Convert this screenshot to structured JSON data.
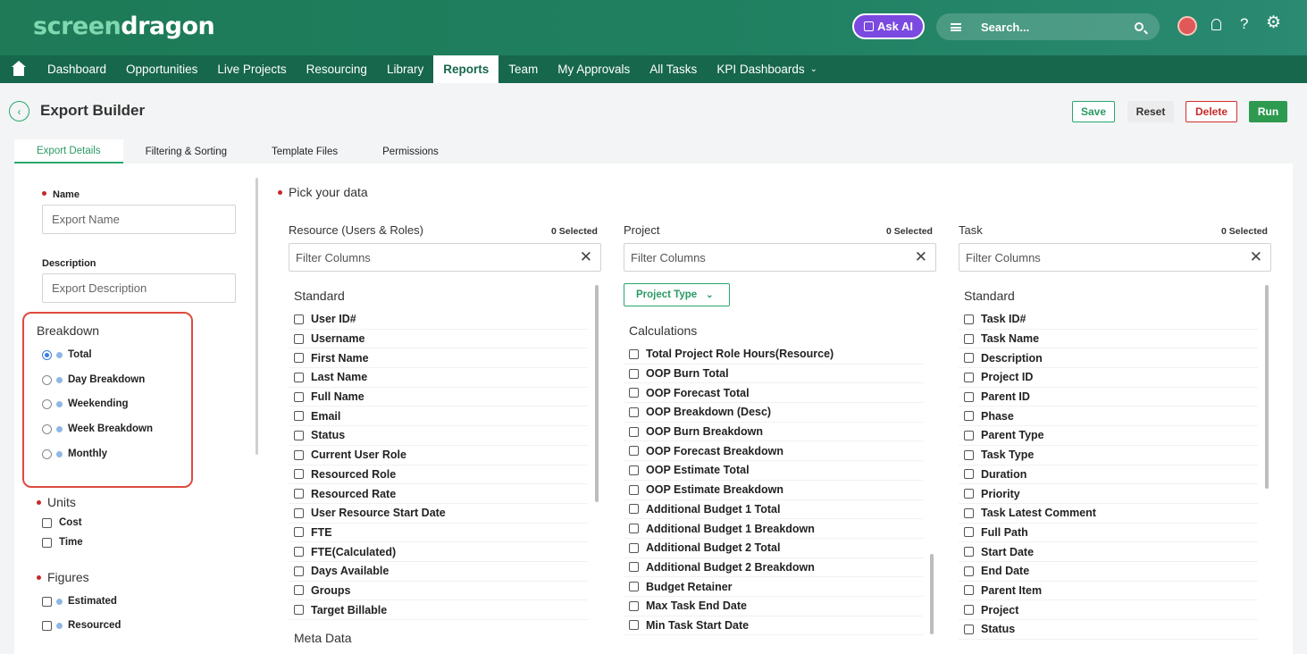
{
  "app": {
    "logo_part1": "screen",
    "logo_part2": "dragon",
    "ask_ai": "Ask AI",
    "search_placeholder": "Search..."
  },
  "nav": {
    "items": [
      "Dashboard",
      "Opportunities",
      "Live Projects",
      "Resourcing",
      "Library",
      "Reports",
      "Team",
      "My Approvals",
      "All Tasks",
      "KPI Dashboards"
    ],
    "active": "Reports"
  },
  "page": {
    "title": "Export Builder",
    "save": "Save",
    "reset": "Reset",
    "delete": "Delete",
    "run": "Run"
  },
  "tabs": [
    "Export Details",
    "Filtering & Sorting",
    "Template Files",
    "Permissions"
  ],
  "form": {
    "name_label": "Name",
    "name_placeholder": "Export Name",
    "desc_label": "Description",
    "desc_placeholder": "Export Description",
    "breakdown_title": "Breakdown",
    "breakdown_options": [
      "Total",
      "Day Breakdown",
      "Weekending",
      "Week Breakdown",
      "Monthly"
    ],
    "breakdown_selected": "Total",
    "units_title": "Units",
    "units": [
      "Cost",
      "Time"
    ],
    "figures_title": "Figures",
    "figures": [
      "Estimated",
      "Resourced"
    ]
  },
  "pick_title": "Pick your data",
  "columns": [
    {
      "title": "Resource (Users & Roles)",
      "selected": "0 Selected",
      "filter_placeholder": "Filter Columns",
      "group": "Standard",
      "items": [
        "User ID#",
        "Username",
        "First Name",
        "Last Name",
        "Full Name",
        "Email",
        "Status",
        "Current User Role",
        "Resourced Role",
        "Resourced Rate",
        "User Resource Start Date",
        "FTE",
        "FTE(Calculated)",
        "Days Available",
        "Groups",
        "Target Billable"
      ],
      "next_group": "Meta Data"
    },
    {
      "title": "Project",
      "selected": "0 Selected",
      "filter_placeholder": "Filter Columns",
      "project_type_button": "Project Type",
      "group": "Calculations",
      "items": [
        "Total Project Role Hours(Resource)",
        "OOP Burn Total",
        "OOP Forecast Total",
        "OOP Breakdown (Desc)",
        "OOP Burn Breakdown",
        "OOP Forecast Breakdown",
        "OOP Estimate Total",
        "OOP Estimate Breakdown",
        "Additional Budget 1 Total",
        "Additional Budget 1 Breakdown",
        "Additional Budget 2 Total",
        "Additional Budget 2 Breakdown",
        "Budget Retainer",
        "Max Task End Date",
        "Min Task Start Date"
      ]
    },
    {
      "title": "Task",
      "selected": "0 Selected",
      "filter_placeholder": "Filter Columns",
      "group": "Standard",
      "items": [
        "Task ID#",
        "Task Name",
        "Description",
        "Project ID",
        "Parent ID",
        "Phase",
        "Parent Type",
        "Task Type",
        "Duration",
        "Priority",
        "Task Latest Comment",
        "Full Path",
        "Start Date",
        "End Date",
        "Parent Item",
        "Project",
        "Status"
      ]
    }
  ]
}
